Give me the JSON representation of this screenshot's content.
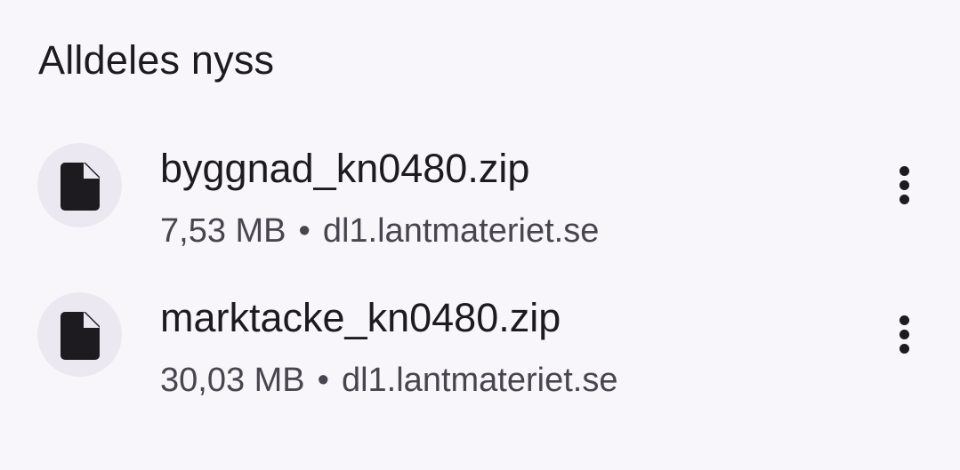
{
  "section": {
    "title": "Alldeles nyss"
  },
  "downloads": [
    {
      "file_name": "byggnad_kn0480.zip",
      "size": "7,53 MB",
      "separator": "•",
      "source": "dl1.lantmateriet.se",
      "icon": "file-icon",
      "menu_icon": "more-vert-icon"
    },
    {
      "file_name": "marktacke_kn0480.zip",
      "size": "30,03 MB",
      "separator": "•",
      "source": "dl1.lantmateriet.se",
      "icon": "file-icon",
      "menu_icon": "more-vert-icon"
    }
  ],
  "colors": {
    "background": "#f8f6fb",
    "icon_circle": "#ece8f1",
    "primary_text": "#1d1b20",
    "secondary_text": "#49454f"
  }
}
